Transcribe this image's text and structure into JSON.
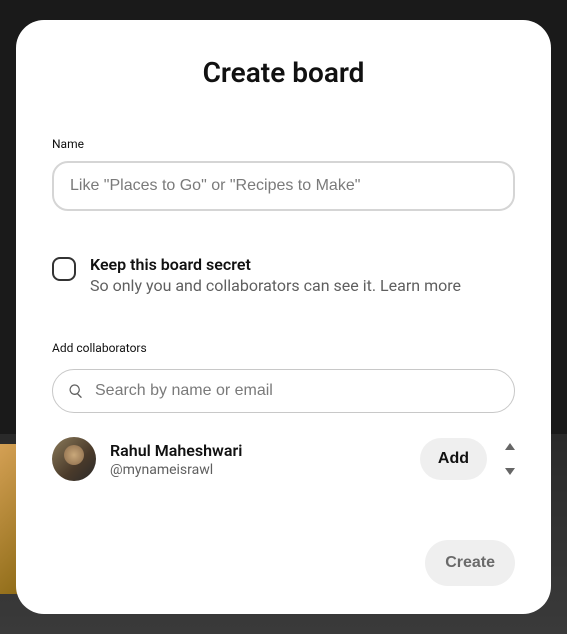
{
  "modal": {
    "title": "Create board",
    "nameField": {
      "label": "Name",
      "placeholder": "Like \"Places to Go\" or \"Recipes to Make\""
    },
    "secret": {
      "title": "Keep this board secret",
      "subtitle": "So only you and collaborators can see it. ",
      "learnMore": "Learn more"
    },
    "collaborators": {
      "label": "Add collaborators",
      "searchPlaceholder": "Search by name or email",
      "suggestions": [
        {
          "name": "Rahul Maheshwari",
          "handle": "@mynameisrawl",
          "addLabel": "Add"
        }
      ]
    },
    "createButton": "Create"
  }
}
